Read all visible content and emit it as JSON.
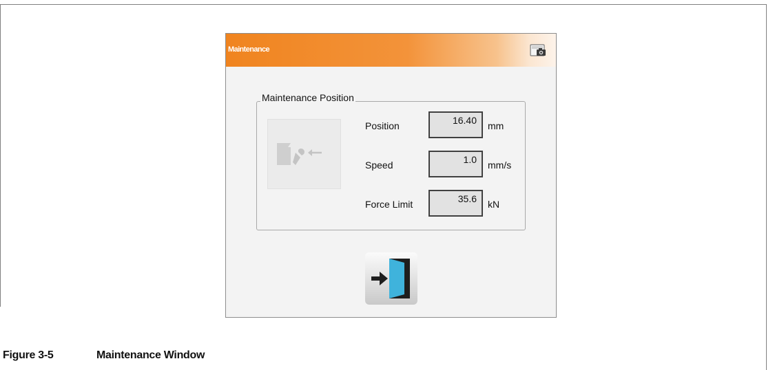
{
  "window": {
    "title": "Maintenance"
  },
  "group": {
    "title": "Maintenance Position"
  },
  "fields": {
    "position": {
      "label": "Position",
      "value": "16.40",
      "unit": "mm"
    },
    "speed": {
      "label": "Speed",
      "value": "1.0",
      "unit": "mm/s"
    },
    "force_limit": {
      "label": "Force Limit",
      "value": "35.6",
      "unit": "kN"
    }
  },
  "icons": {
    "titlebar": "screenshot-camera-icon",
    "group": "maintenance-wrench-icon",
    "exit": "exit-door-icon"
  },
  "colors": {
    "titlebar": "#f0841f",
    "exit_door": "#3fb3dc"
  },
  "caption": {
    "figure_number": "Figure 3-5",
    "figure_title": "Maintenance Window"
  }
}
